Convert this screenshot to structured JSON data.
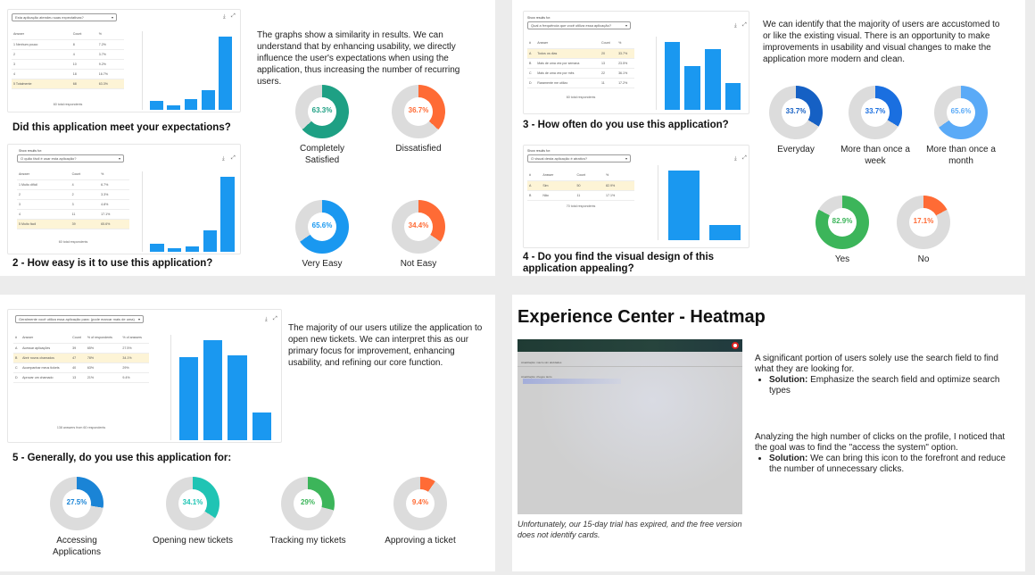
{
  "slide1": {
    "form1": {
      "select": "Esta aplicação atendeu suas expectativas?",
      "columns": [
        "Answer",
        "Count",
        "%"
      ],
      "rows": [
        [
          "1 Nenhum pouco",
          "8",
          "7.2%"
        ],
        [
          "2",
          "4",
          "3.7%"
        ],
        [
          "3",
          "10",
          "9.2%"
        ],
        [
          "4",
          "18",
          "16.7%"
        ],
        [
          "5 Totalmente",
          "68",
          "63.3%"
        ]
      ],
      "footer": "60 total respondents",
      "bars": [
        8,
        4,
        10,
        18,
        68
      ]
    },
    "q1_title": "Did this application meet your expectations?",
    "form2": {
      "header": "Show results for:",
      "select": "O quão fácil é usar esta aplicação?",
      "columns": [
        "Answer",
        "Count",
        "%"
      ],
      "rows": [
        [
          "1 Muito difícil",
          "4",
          "6.7%"
        ],
        [
          "2",
          "2",
          "3.3%"
        ],
        [
          "3",
          "3",
          "4.8%"
        ],
        [
          "4",
          "11",
          "17.1%"
        ],
        [
          "5 Muito fácil",
          "39",
          "65.6%"
        ]
      ],
      "footer": "60 total respondents",
      "bars": [
        4,
        2,
        3,
        11,
        39
      ]
    },
    "q2_title": "2 - How easy is it to use this application?",
    "paragraph": "The graphs show a similarity in results. We can understand that by enhancing usability, we directly influence the user's expectations when using the application, thus increasing the number of recurring users.",
    "donuts": [
      {
        "pct": "63.3%",
        "value": 63.3,
        "label": "Completely Satisfied",
        "color": "#1ea084"
      },
      {
        "pct": "36.7%",
        "value": 36.7,
        "label": "Dissatisfied",
        "color": "#ff6b35"
      },
      {
        "pct": "65.6%",
        "value": 65.6,
        "label": "Very Easy",
        "color": "#1a98f0"
      },
      {
        "pct": "34.4%",
        "value": 34.4,
        "label": "Not Easy",
        "color": "#ff6b35"
      }
    ]
  },
  "slide2": {
    "form3": {
      "header": "Show results for:",
      "select": "Qual a frequência que você utiliza essa aplicação?",
      "columns": [
        "#",
        "Answer",
        "Count",
        "%"
      ],
      "rows": [
        [
          "A",
          "Todos os dias",
          "20",
          "33.7%"
        ],
        [
          "B",
          "Mais de uma vez por semana",
          "13",
          "23.5%"
        ],
        [
          "C",
          "Mais de uma vez por mês",
          "22",
          "36.1%"
        ],
        [
          "D",
          "Raramente me utilizo",
          "11",
          "17.2%"
        ]
      ],
      "footer": "60 total respondents",
      "bars": [
        20,
        13,
        18,
        8
      ]
    },
    "q3_title": "3 - How often do you use this application?",
    "form4": {
      "header": "Show results for:",
      "select": "O visual desta aplicação é atrativo?",
      "columns": [
        "#",
        "Answer",
        "Count",
        "%"
      ],
      "rows": [
        [
          "A",
          "Sim",
          "50",
          "82.9%"
        ],
        [
          "B",
          "Não",
          "11",
          "17.1%"
        ]
      ],
      "footer": "70 total respondents",
      "bars": [
        50,
        11
      ]
    },
    "q4_title": "4 - Do you find the visual design of this application appealing?",
    "paragraph": "We can identify that the majority of users are accustomed to or like the existing visual. There is an opportunity to make improvements in usability and visual changes to make the application more modern and clean.",
    "donuts": [
      {
        "pct": "33.7%",
        "value": 33.7,
        "label": "Everyday",
        "color": "#1560c4"
      },
      {
        "pct": "33.7%",
        "value": 33.7,
        "label": "More than once a week",
        "color": "#1a6fe0"
      },
      {
        "pct": "65.6%",
        "value": 65.6,
        "label": "More than once a month",
        "color": "#5aaaf7"
      },
      {
        "pct": "82.9%",
        "value": 82.9,
        "label": "Yes",
        "color": "#3cb55a"
      },
      {
        "pct": "17.1%",
        "value": 17.1,
        "label": "No",
        "color": "#ff6b35"
      }
    ]
  },
  "slide3": {
    "form5": {
      "select": "Geralmente você utiliza essa aplicação para: (pode marcar mais de uma)",
      "columns": [
        "#",
        "Answer",
        "Count",
        "% of respondents",
        "% of answers"
      ],
      "rows": [
        [
          "A",
          "Acessar aplicações",
          "39",
          "65%",
          "27.5%"
        ],
        [
          "B",
          "Abrir novos chamados",
          "47",
          "78%",
          "34.1%"
        ],
        [
          "C",
          "Acompanhar meus tickets",
          "40",
          "63%",
          "29%"
        ],
        [
          "D",
          "Aprovar um chamado",
          "13",
          "21%",
          "9.4%"
        ]
      ],
      "footer": "138 answers from 60 respondents",
      "bars": [
        39,
        47,
        40,
        13
      ]
    },
    "q5_title": "5 - Generally, do you use this application for:",
    "paragraph": "The majority of our users utilize the application to open new tickets. We can interpret this as our primary focus for improvement, enhancing usability, and refining our core function.",
    "donuts": [
      {
        "pct": "27.5%",
        "value": 27.5,
        "label": "Accessing Applications",
        "color": "#1a84d6"
      },
      {
        "pct": "34.1%",
        "value": 34.1,
        "label": "Opening new tickets",
        "color": "#1fc4b4"
      },
      {
        "pct": "29%",
        "value": 29,
        "label": "Tracking my tickets",
        "color": "#3cb55a"
      },
      {
        "pct": "9.4%",
        "value": 9.4,
        "label": "Approving a ticket",
        "color": "#ff6b35"
      }
    ]
  },
  "slide4": {
    "heading": "Experience Center - Heatmap",
    "heat_text1": "Atualização: macro sim atividades",
    "heat_text2": "Atualização: chegou tanto",
    "caption": "Unfortunately, our 15-day trial has expired, and the free version does not identify cards.",
    "block1": {
      "text": "A significant portion of users solely use the search field to find what they are looking for.",
      "sol_label": "Solution:",
      "sol_text": "Emphasize the search field and optimize search types"
    },
    "block2": {
      "text": "Analyzing the high number of clicks on the profile, I noticed that the goal was to find the \"access the system\" option.",
      "sol_label": "Solution:",
      "sol_text": "We can bring this icon to the forefront and reduce the number of unnecessary clicks."
    }
  }
}
